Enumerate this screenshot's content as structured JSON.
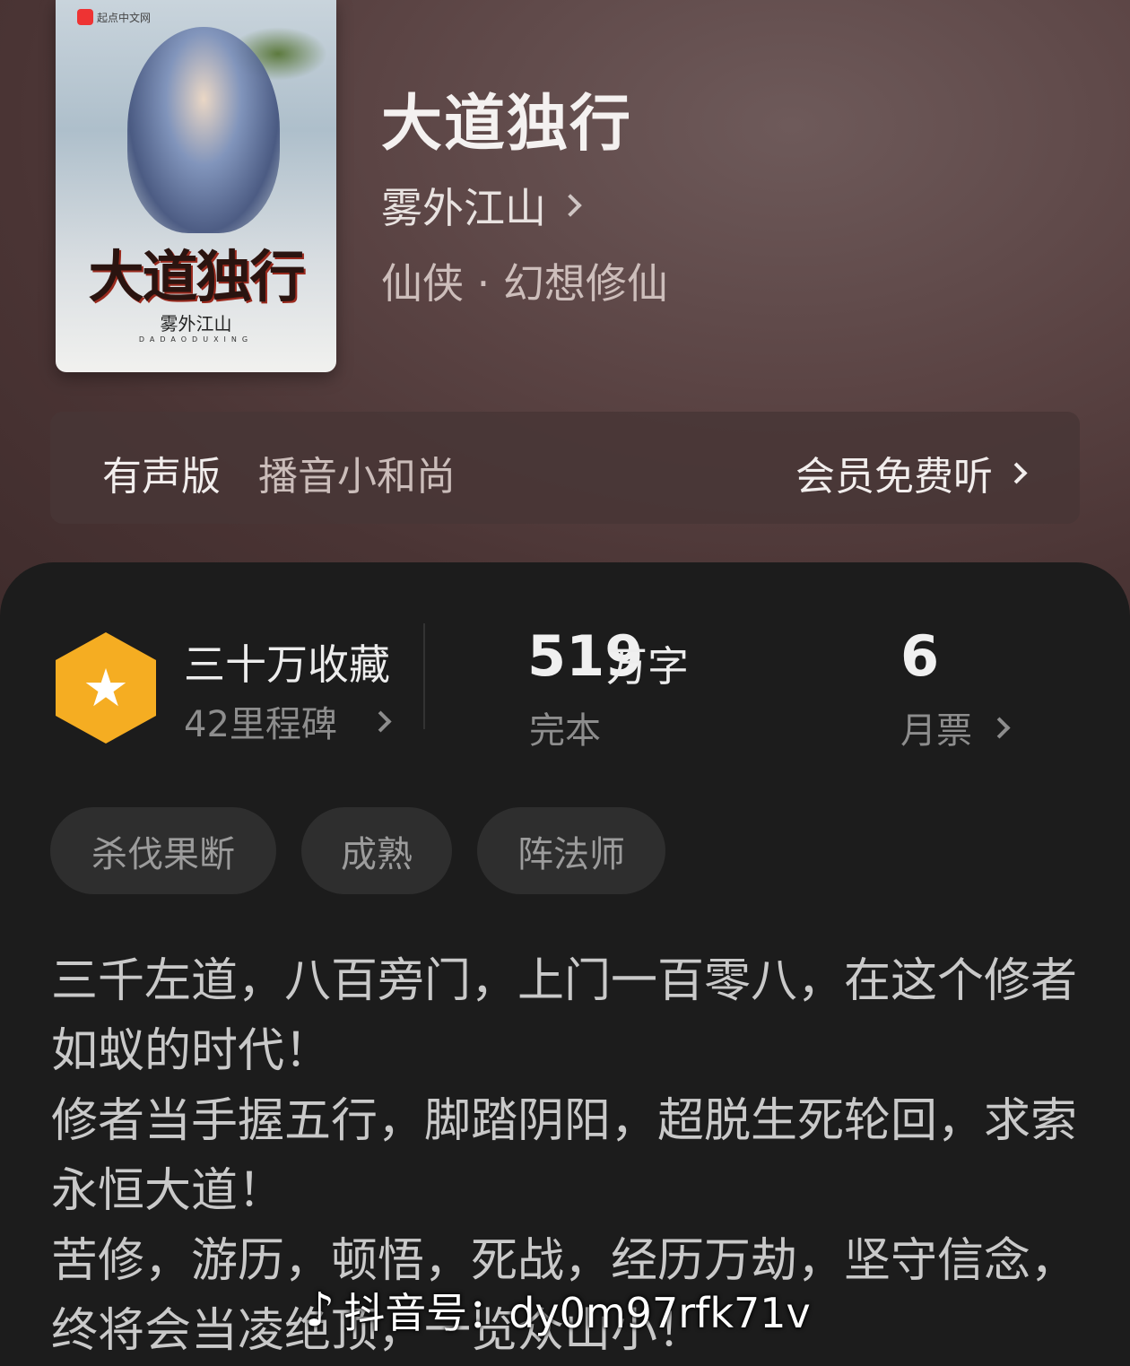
{
  "cover": {
    "publisher": "起点中文网",
    "title": "大道独行",
    "author": "雾外江山",
    "pinyin": "DADAODUXING"
  },
  "book": {
    "title": "大道独行",
    "author": "雾外江山",
    "genre": "仙侠 · 幻想修仙"
  },
  "audio": {
    "label": "有声版",
    "narrator": "播音小和尚",
    "action": "会员免费听"
  },
  "stats": {
    "favorites": "三十万收藏",
    "milestones": "42里程碑",
    "word_count": "519",
    "word_unit": "万字",
    "status": "完本",
    "monthly_votes": "6",
    "monthly_votes_label": "月票"
  },
  "tags": [
    "杀伐果断",
    "成熟",
    "阵法师"
  ],
  "description": [
    "三千左道，八百旁门，上门一百零八，在这个修者如蚁的时代！",
    "修者当手握五行，脚踏阴阳，超脱生死轮回，求索永恒大道！",
    "苦修，游历，顿悟，死战，经历万劫，坚守信念，终将会当凌绝顶，一览众山小！"
  ],
  "watermark": "抖音号：dy0m97rfk71v",
  "colors": {
    "accent": "#f5ad22",
    "hero_bg": "#5a4343",
    "sheet_bg": "#1c1c1c"
  }
}
